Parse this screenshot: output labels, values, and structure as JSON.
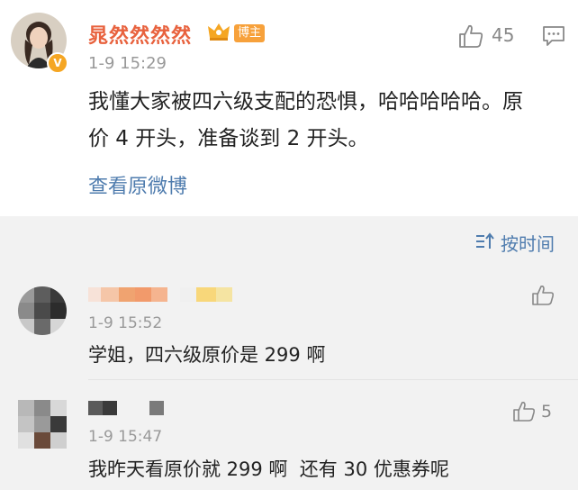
{
  "post": {
    "author": "晁然然然然",
    "host_badge": "博主",
    "time": "1-9 15:29",
    "like_count": "45",
    "text": "我懂大家被四六级支配的恐惧，哈哈哈哈哈。原价 4 开头，准备谈到 2 开头。",
    "view_original": "查看原微博"
  },
  "sort": {
    "label": "按时间"
  },
  "comments": [
    {
      "time": "1-9 15:52",
      "text": "学姐，四六级原价是 299 啊",
      "like_count": ""
    },
    {
      "time": "1-9 15:47",
      "text": "我昨天看原价就 299 啊  还有 30 优惠券呢",
      "like_count": "5"
    }
  ],
  "colors": {
    "accent_orange": "#e8623e",
    "link_blue": "#4f7cae",
    "badge_orange": "#f7a13b"
  }
}
